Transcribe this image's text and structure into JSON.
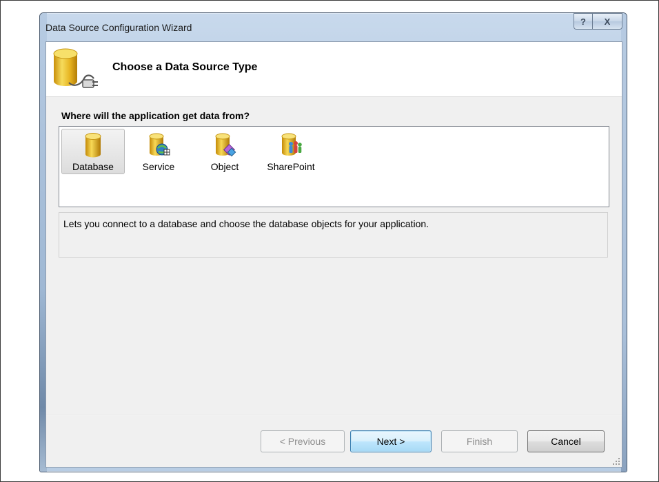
{
  "window": {
    "title": "Data Source Configuration Wizard",
    "help_glyph": "?",
    "close_glyph": "X"
  },
  "header": {
    "title": "Choose a Data Source Type",
    "icon": "database-plug-icon"
  },
  "question": "Where will the application get data from?",
  "source_types": [
    {
      "label": "Database",
      "icon": "database-icon",
      "selected": true
    },
    {
      "label": "Service",
      "icon": "service-icon",
      "selected": false
    },
    {
      "label": "Object",
      "icon": "object-icon",
      "selected": false
    },
    {
      "label": "SharePoint",
      "icon": "sharepoint-icon",
      "selected": false
    }
  ],
  "description": "Lets you connect to a database and choose the database objects for your application.",
  "buttons": {
    "previous": "< Previous",
    "next": "Next >",
    "finish": "Finish",
    "cancel": "Cancel"
  },
  "colors": {
    "accent_button_border": "#3c7fb1",
    "cylinder_gold": "#e6b21f"
  }
}
